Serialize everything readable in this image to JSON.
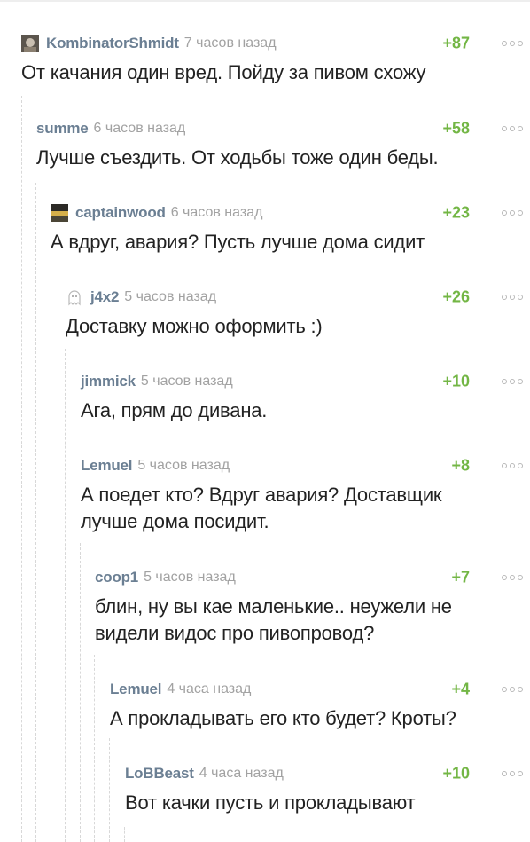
{
  "comments": [
    {
      "user": "KombinatorShmidt",
      "time": "7 часов назад",
      "rating": "+87",
      "text": "От качания один вред. Пойду за пивом схожу",
      "avatar": "photo-avatar-icon"
    },
    {
      "user": "summe",
      "time": "6 часов назад",
      "rating": "+58",
      "text": "Лучше съездить. От ходьбы тоже один беды."
    },
    {
      "user": "captainwood",
      "time": "6 часов назад",
      "rating": "+23",
      "text": "А вдруг, авария? Пусть лучше дома сидит",
      "avatar": "photo-avatar-icon"
    },
    {
      "user": "j4x2",
      "time": "5 часов назад",
      "rating": "+26",
      "text": "Доставку можно оформить :)",
      "avatar": "ghost-avatar-icon"
    },
    {
      "user": "jimmick",
      "time": "5 часов назад",
      "rating": "+10",
      "text": "Ага, прям до дивана."
    },
    {
      "user": "Lemuel",
      "time": "5 часов назад",
      "rating": "+8",
      "text": "А поедет кто? Вдруг авария? Доставщик лучше дома посидит."
    },
    {
      "user": "coop1",
      "time": "5 часов назад",
      "rating": "+7",
      "text": "блин, ну вы кае маленькие.. неужели не видели видос про пивопровод?"
    },
    {
      "user": "Lemuel",
      "time": "4 часа назад",
      "rating": "+4",
      "text": "А прокладывать его кто будет? Кроты?"
    },
    {
      "user": "LoBBeast",
      "time": "4 часа назад",
      "rating": "+10",
      "text": "Вот качки пусть и прокладывают"
    }
  ],
  "colors": {
    "username": "#6b7f93",
    "time": "#a2a2a2",
    "rating": "#73b645",
    "text": "#222222",
    "thread_line": "#d8d8d8"
  }
}
